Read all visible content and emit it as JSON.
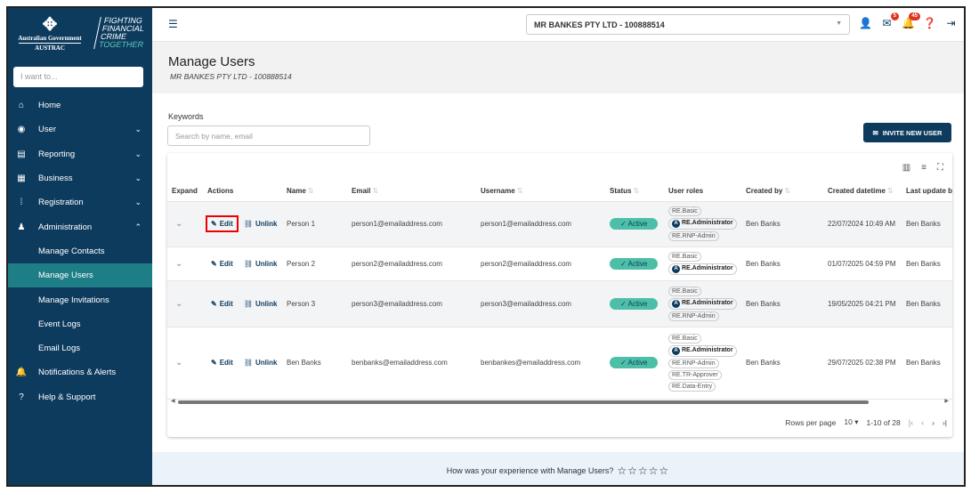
{
  "branding": {
    "gov": "Australian Government",
    "agency": "AUSTRAC",
    "tagline": [
      "FIGHTING",
      "FINANCIAL",
      "CRIME",
      "TOGETHER"
    ]
  },
  "search": {
    "placeholder": "I want to..."
  },
  "nav": [
    {
      "label": "Home",
      "icon": "home-icon",
      "glyph": "⌂"
    },
    {
      "label": "User",
      "icon": "user-circle-icon",
      "glyph": "◉",
      "chev": "⌄"
    },
    {
      "label": "Reporting",
      "icon": "file-icon",
      "glyph": "▤",
      "chev": "⌄"
    },
    {
      "label": "Business",
      "icon": "building-icon",
      "glyph": "▦",
      "chev": "⌄"
    },
    {
      "label": "Registration",
      "icon": "registration-icon",
      "glyph": "⁞",
      "chev": "⌄"
    },
    {
      "label": "Administration",
      "icon": "admin-users-icon",
      "glyph": "♟",
      "chev": "⌃"
    },
    {
      "label": "Manage Contacts"
    },
    {
      "label": "Manage Users"
    },
    {
      "label": "Manage Invitations"
    },
    {
      "label": "Event Logs"
    },
    {
      "label": "Email Logs"
    },
    {
      "label": "Notifications & Alerts",
      "icon": "bell-icon",
      "glyph": "🔔"
    },
    {
      "label": "Help & Support",
      "icon": "help-book-icon",
      "glyph": "?"
    }
  ],
  "header": {
    "entity": "MR BANKES PTY LTD - 100888514",
    "mail_count": "5",
    "notif_count": "45"
  },
  "page": {
    "title": "Manage Users",
    "subtitle": "MR BANKES PTY LTD - 100888514",
    "keywords_label": "Keywords",
    "keywords_placeholder": "Search by name, email",
    "invite_label": "INVITE NEW USER"
  },
  "table": {
    "columns": [
      "Expand",
      "Actions",
      "Name",
      "Email",
      "Username",
      "Status",
      "User roles",
      "Created by",
      "Created datetime",
      "Last update by"
    ],
    "edit_label": "Edit",
    "unlink_label": "Unlink",
    "rows": [
      {
        "name": "Person 1",
        "email": "person1@emailaddress.com",
        "username": "person1@emailaddress.com",
        "status": "Active",
        "roles": [
          "RE.Basic",
          "RE.Administrator",
          "RE.RNP-Admin"
        ],
        "created_by": "Ben Banks",
        "created": "22/07/2024 10:49 AM",
        "updated_by": "Ben Banks"
      },
      {
        "name": "Person 2",
        "email": "person2@emailaddress.com",
        "username": "person2@emailaddress.com",
        "status": "Active",
        "roles": [
          "RE.Basic",
          "RE.Administrator"
        ],
        "created_by": "Ben Banks",
        "created": "01/07/2025 04:59 PM",
        "updated_by": "Ben Banks"
      },
      {
        "name": "Person 3",
        "email": "person3@emailaddress.com",
        "username": "person3@emailaddress.com",
        "status": "Active",
        "roles": [
          "RE.Basic",
          "RE.Administrator",
          "RE.RNP-Admin"
        ],
        "created_by": "Ben Banks",
        "created": "19/05/2025 04:21 PM",
        "updated_by": "Ben Banks"
      },
      {
        "name": "Ben Banks",
        "email": "benbanks@emailaddress.com",
        "username": "benbankes@emailaddress.com",
        "status": "Active",
        "roles": [
          "RE.Basic",
          "RE.Administrator",
          "RE.RNP-Admin",
          "RE.TR-Approver",
          "RE.Data-Entry"
        ],
        "created_by": "Ben Banks",
        "created": "29/07/2025 02:38 PM",
        "updated_by": "Ben Banks"
      }
    ]
  },
  "pagination": {
    "rows_label": "Rows per page",
    "rows_value": "10",
    "range": "1-10 of 28"
  },
  "feedback": {
    "question": "How was your experience with Manage Users?",
    "stars": "☆☆☆☆☆"
  },
  "colors": {
    "navy": "#0d3b5e",
    "teal": "#1e7e88",
    "active": "#4cbfa6"
  }
}
